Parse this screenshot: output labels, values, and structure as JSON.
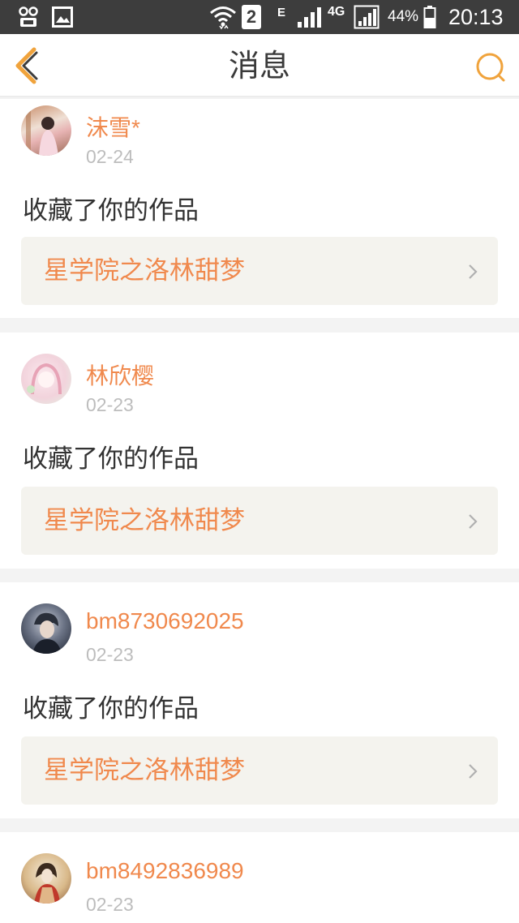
{
  "status_bar": {
    "sim_badge": "2",
    "network_e": "E",
    "network_4g": "4G",
    "battery": "44%",
    "time": "20:13"
  },
  "nav": {
    "title": "消息",
    "accent_color": "#f0a33c"
  },
  "messages": [
    {
      "username": "沫雪*",
      "date": "02-24",
      "action": "收藏了你的作品",
      "work_title": "星学院之洛林甜梦"
    },
    {
      "username": "林欣樱",
      "date": "02-23",
      "action": "收藏了你的作品",
      "work_title": "星学院之洛林甜梦"
    },
    {
      "username": "bm8730692025",
      "date": "02-23",
      "action": "收藏了你的作品",
      "work_title": "星学院之洛林甜梦"
    },
    {
      "username": "bm8492836989",
      "date": "02-23"
    }
  ],
  "colors": {
    "username": "#f0894d",
    "date": "#bdbdbd",
    "work_background": "#f4f3ee"
  }
}
